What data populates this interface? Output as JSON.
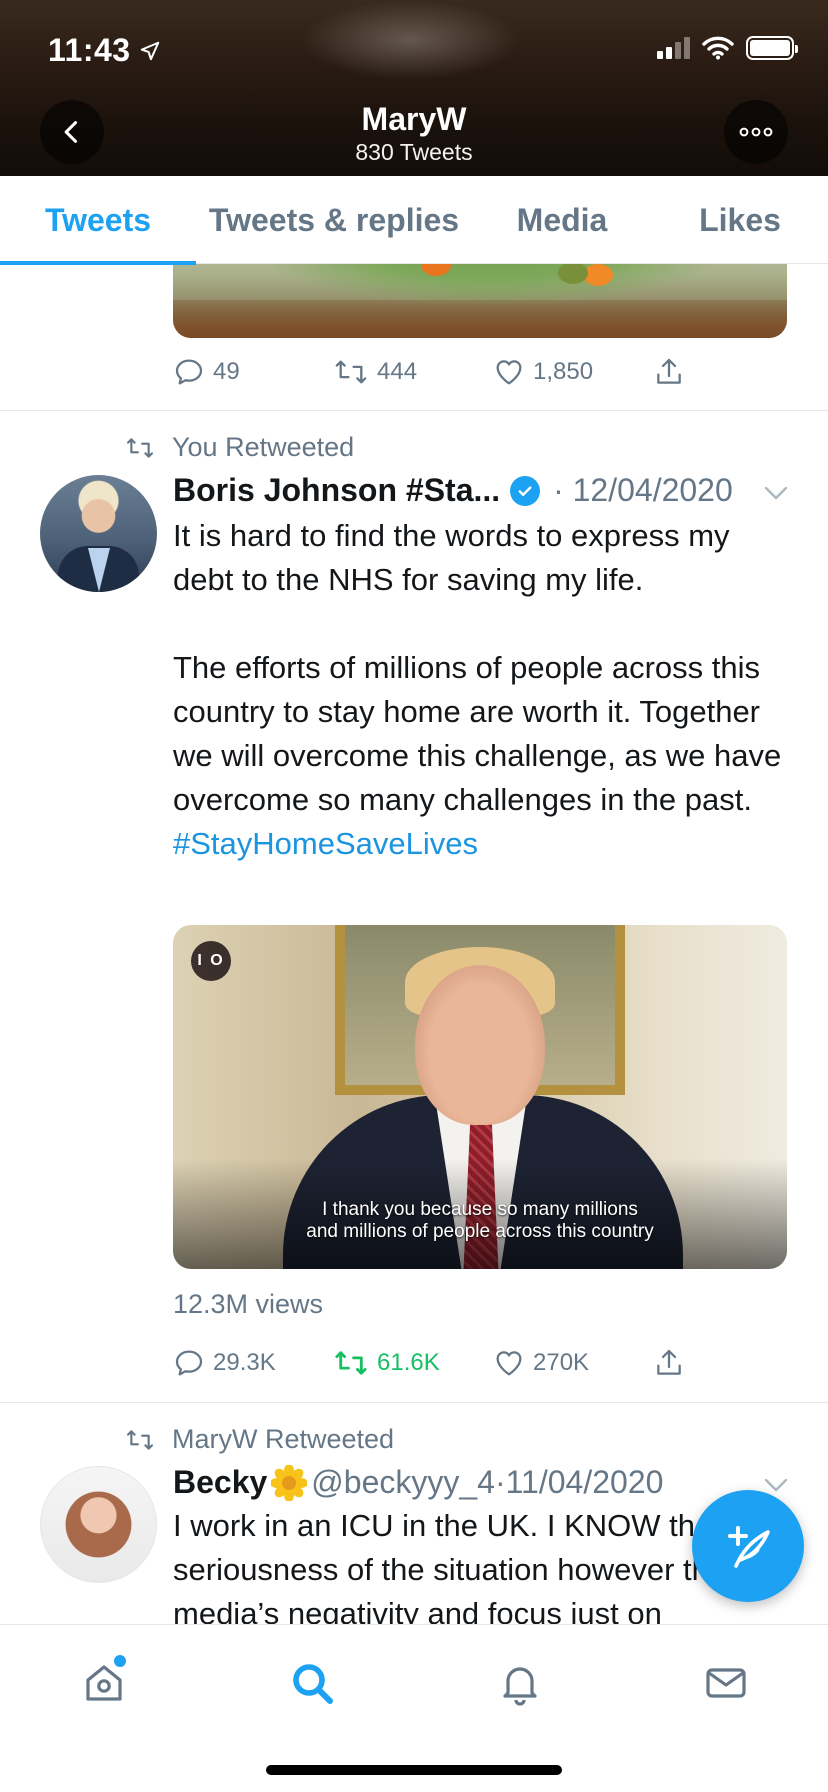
{
  "status_bar": {
    "time": "11:43"
  },
  "header": {
    "name": "MaryW",
    "tweet_count": "830 Tweets"
  },
  "tabs": [
    {
      "label": "Tweets",
      "active": true
    },
    {
      "label": "Tweets & replies",
      "active": false
    },
    {
      "label": "Media",
      "active": false
    },
    {
      "label": "Likes",
      "active": false
    }
  ],
  "prev_tweet": {
    "replies": "49",
    "retweets": "444",
    "likes": "1,850"
  },
  "tweet1": {
    "retweet_context": "You Retweeted",
    "name": "Boris Johnson #Sta...",
    "date": "12/04/2020",
    "text_p1": "It is hard to find the words to express my debt to the NHS for saving my life.",
    "text_p2": "The efforts of millions of people across this country to stay home are worth it. Together we will overcome this challenge, as we have overcome so many challenges in the past.",
    "hashtag": "#StayHomeSaveLives",
    "video_badge": "I O",
    "video_caption_1": "I thank you because so many millions",
    "video_caption_2": "and millions of people across this country",
    "views": "12.3M views",
    "replies": "29.3K",
    "retweets": "61.6K",
    "likes": "270K"
  },
  "tweet2": {
    "retweet_context": "MaryW Retweeted",
    "name": "Becky",
    "handle": "@beckyyy_4",
    "date": "11/04/2020",
    "text": "I work in an ICU in the UK. I KNOW the seriousness of the situation however the media’s negativity and focus just on"
  },
  "colors": {
    "accent": "#1da1f2",
    "retweet_active": "#17bf63",
    "muted": "#657786"
  },
  "icons": [
    "location-arrow-icon",
    "signal-icon",
    "wifi-icon",
    "battery-icon",
    "back-arrow-icon",
    "more-icon",
    "reply-icon",
    "retweet-icon",
    "like-icon",
    "share-icon",
    "verified-icon",
    "chevron-down-icon",
    "compose-icon",
    "home-icon",
    "search-icon",
    "bell-icon",
    "mail-icon"
  ]
}
